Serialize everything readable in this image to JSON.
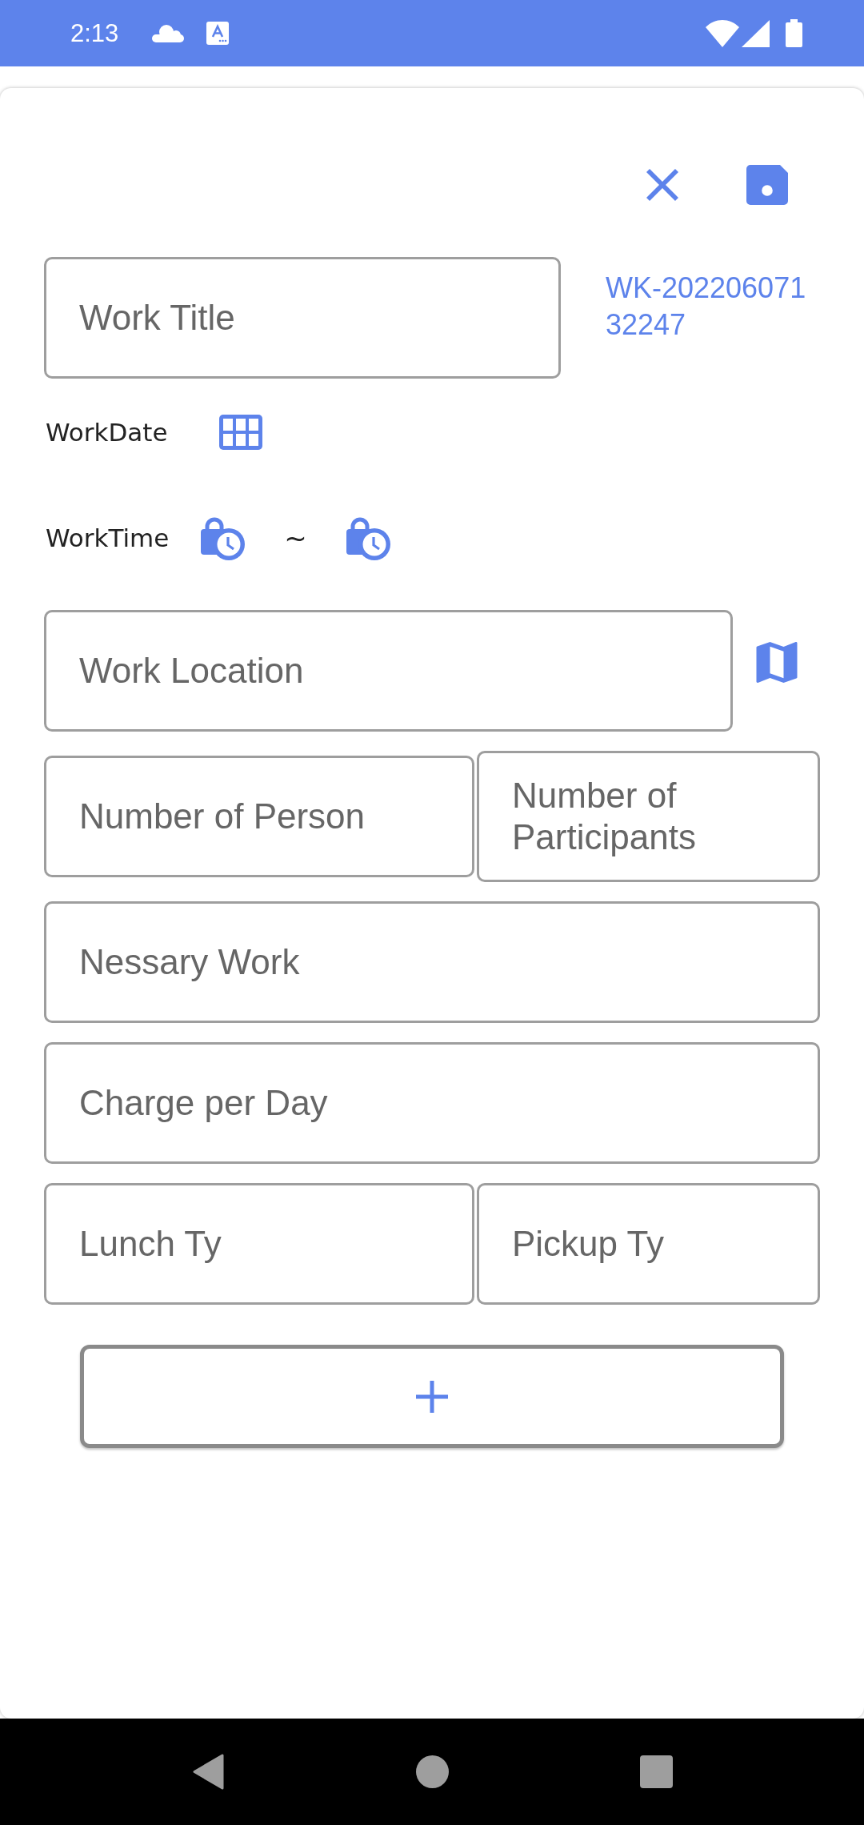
{
  "status_bar": {
    "time": "2:13"
  },
  "form": {
    "title_field": {
      "placeholder": "Work Title"
    },
    "work_code": "WK-20220607132247",
    "date_row": {
      "label": "WorkDate"
    },
    "time_row": {
      "label": "WorkTime",
      "separator": "~"
    },
    "location_field": {
      "placeholder": "Work Location"
    },
    "field_rows": [
      {
        "fields": [
          {
            "placeholder": "Number of Person"
          },
          {
            "placeholder": "Number of Participants"
          }
        ]
      },
      {
        "fields": [
          {
            "placeholder": "Nessary Work"
          }
        ]
      },
      {
        "fields": [
          {
            "placeholder": "Charge per Day"
          }
        ]
      },
      {
        "fields": [
          {
            "placeholder": "Lunch Ty"
          },
          {
            "placeholder": "Pickup Ty"
          }
        ]
      }
    ]
  }
}
